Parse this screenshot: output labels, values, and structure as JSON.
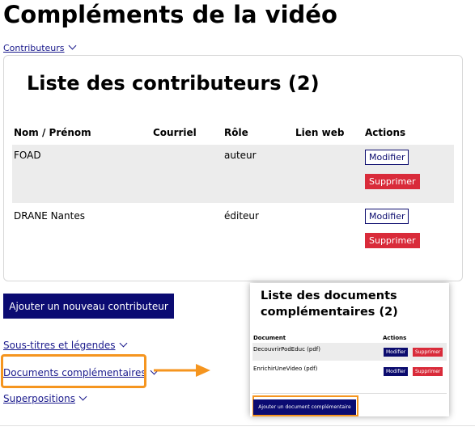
{
  "page_title": "Compléments de la vidéo",
  "contributors_toggle": "Contributeurs",
  "contributors": {
    "heading": "Liste des contributeurs (2)",
    "columns": [
      "Nom / Prénom",
      "Courriel",
      "Rôle",
      "Lien web",
      "Actions"
    ],
    "rows": [
      {
        "name": "FOAD",
        "email": "",
        "role": "auteur",
        "web": "",
        "edit": "Modifier",
        "delete": "Supprimer"
      },
      {
        "name": "DRANE Nantes",
        "email": "",
        "role": "éditeur",
        "web": "",
        "edit": "Modifier",
        "delete": "Supprimer"
      }
    ]
  },
  "add_contributor_label": "Ajouter un nouveau contributeur",
  "sections": {
    "subtitles": "Sous-titres et légendes",
    "documents": "Documents complémentaires",
    "overlays": "Superpositions"
  },
  "documents_panel": {
    "heading": "Liste des documents complémentaires (2)",
    "columns": [
      "Document",
      "Actions"
    ],
    "rows": [
      {
        "name": "DecouvrirPodEduc (pdf)",
        "edit": "Modifier",
        "delete": "Supprimer"
      },
      {
        "name": "EnrichirUneVideo (pdf)",
        "edit": "Modifier",
        "delete": "Supprimer"
      }
    ],
    "add_label": "Ajouter un document complémentaire"
  },
  "colors": {
    "primary": "#0b0b72",
    "danger": "#d92b3a",
    "highlight": "#f5951f",
    "link": "#1a1a8c"
  },
  "icons": [
    "chevron-down-icon",
    "arrow-right-icon"
  ]
}
